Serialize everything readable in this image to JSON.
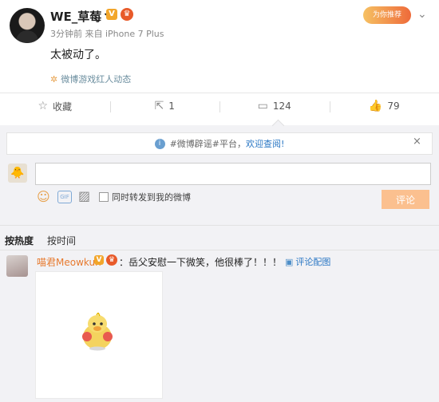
{
  "post": {
    "username": "WE_草莓丶",
    "time": "3分钟前",
    "source": "来自 iPhone 7 Plus",
    "text": "太被动了。",
    "source_link": "微博游戏红人动态",
    "top_badge": "为你推荐"
  },
  "actions": {
    "favorite": "收藏",
    "repost_count": "1",
    "comment_count": "124",
    "like_count": "79"
  },
  "notice": {
    "prefix": "#微博辟谣#平台，",
    "link": "欢迎查阅!",
    "close": "×"
  },
  "composer": {
    "input_value": "",
    "repost_label": "同时转发到我的微博",
    "submit_label": "评论"
  },
  "sort": {
    "hot": "按热度",
    "time": "按时间"
  },
  "comment": {
    "name": "喵君Meowkun",
    "text": "：岳父安慰一下微笑，他很棒了！！！",
    "pic_link": "评论配图"
  },
  "icons": {
    "favorite": "star-icon",
    "repost": "repost-icon",
    "comment": "comment-icon",
    "like": "thumbs-up-icon",
    "info": "info-icon",
    "emoji": "emoji-icon",
    "gif": "gif-icon",
    "image": "image-icon",
    "chevron": "chevron-down-icon"
  },
  "colors": {
    "accent": "#fbc08f",
    "link": "#2a77c4",
    "name": "#e77a2f"
  }
}
